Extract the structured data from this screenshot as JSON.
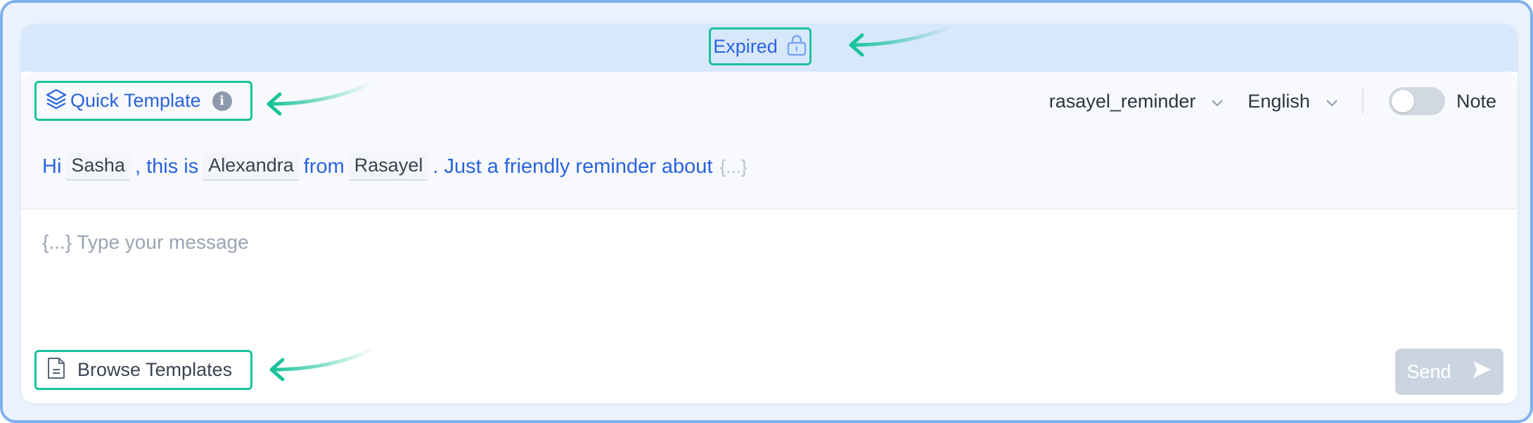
{
  "banner": {
    "status_label": "Expired",
    "status_icon": "lock-icon"
  },
  "toolbar": {
    "quick_template_label": "Quick Template",
    "quick_template_icon": "layers-icon",
    "info_icon_glyph": "i",
    "template_select_value": "rasayel_reminder",
    "language_select_value": "English",
    "note_toggle_label": "Note",
    "note_toggle_on": false
  },
  "template_preview": {
    "t1": "Hi",
    "var1": "Sasha",
    "t2": ", this is",
    "var2": "Alexandra",
    "t3": "from",
    "var3": "Rasayel",
    "t4": ". Just a friendly reminder about",
    "trailing_placeholder": "{...}"
  },
  "composer": {
    "placeholder": "{...} Type your message"
  },
  "footer": {
    "browse_templates_label": "Browse Templates",
    "browse_icon": "document-icon",
    "send_label": "Send",
    "send_icon": "send-icon"
  },
  "colors": {
    "accent": "#2a63dd",
    "highlight_border": "#19c39b",
    "banner_bg": "#d7e7fc",
    "send_disabled_bg": "#cbd5e2"
  }
}
